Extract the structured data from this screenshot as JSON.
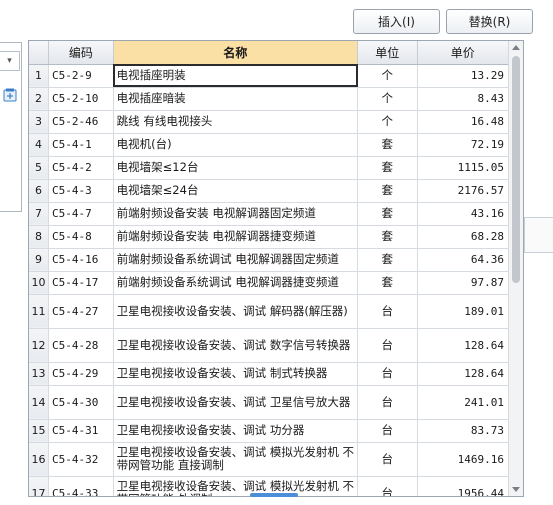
{
  "toolbar": {
    "insert_label": "插入(I)",
    "replace_label": "替换(R)"
  },
  "left_panel": {
    "dropdown_glyph": "▾"
  },
  "table": {
    "headers": {
      "rownum": "",
      "code": "编码",
      "name": "名称",
      "unit": "单位",
      "price": "单价"
    },
    "rows": [
      {
        "n": "1",
        "code": "C5-2-9",
        "name": "电视插座明装",
        "unit": "个",
        "price": "13.29"
      },
      {
        "n": "2",
        "code": "C5-2-10",
        "name": "电视插座暗装",
        "unit": "个",
        "price": "8.43"
      },
      {
        "n": "3",
        "code": "C5-2-46",
        "name": "跳线 有线电视接头",
        "unit": "个",
        "price": "16.48"
      },
      {
        "n": "4",
        "code": "C5-4-1",
        "name": "电视机(台)",
        "unit": "套",
        "price": "72.19"
      },
      {
        "n": "5",
        "code": "C5-4-2",
        "name": "电视墙架≤12台",
        "unit": "套",
        "price": "1115.05"
      },
      {
        "n": "6",
        "code": "C5-4-3",
        "name": "电视墙架≤24台",
        "unit": "套",
        "price": "2176.57"
      },
      {
        "n": "7",
        "code": "C5-4-7",
        "name": "前端射频设备安装 电视解调器固定频道",
        "unit": "套",
        "price": "43.16"
      },
      {
        "n": "8",
        "code": "C5-4-8",
        "name": "前端射频设备安装 电视解调器捷变频道",
        "unit": "套",
        "price": "68.28"
      },
      {
        "n": "9",
        "code": "C5-4-16",
        "name": "前端射频设备系统调试 电视解调器固定频道",
        "unit": "套",
        "price": "64.36"
      },
      {
        "n": "10",
        "code": "C5-4-17",
        "name": "前端射频设备系统调试 电视解调器捷变频道",
        "unit": "套",
        "price": "97.87"
      },
      {
        "n": "11",
        "code": "C5-4-27",
        "name": "卫星电视接收设备安装、调试 解码器(解压器)",
        "unit": "台",
        "price": "189.01"
      },
      {
        "n": "12",
        "code": "C5-4-28",
        "name": "卫星电视接收设备安装、调试 数字信号转换器",
        "unit": "台",
        "price": "128.64"
      },
      {
        "n": "13",
        "code": "C5-4-29",
        "name": "卫星电视接收设备安装、调试 制式转换器",
        "unit": "台",
        "price": "128.64"
      },
      {
        "n": "14",
        "code": "C5-4-30",
        "name": "卫星电视接收设备安装、调试 卫星信号放大器",
        "unit": "台",
        "price": "241.01"
      },
      {
        "n": "15",
        "code": "C5-4-31",
        "name": "卫星电视接收设备安装、调试 功分器",
        "unit": "台",
        "price": "83.73"
      },
      {
        "n": "16",
        "code": "C5-4-32",
        "name": "卫星电视接收设备安装、调试 模拟光发射机 不带网管功能 直接调制",
        "unit": "台",
        "price": "1469.16"
      },
      {
        "n": "17",
        "code": "C5-4-33",
        "name": "卫星电视接收设备安装、调试 模拟光发射机 不带网管功能 外调制",
        "unit": "台",
        "price": "1956.44"
      }
    ]
  }
}
